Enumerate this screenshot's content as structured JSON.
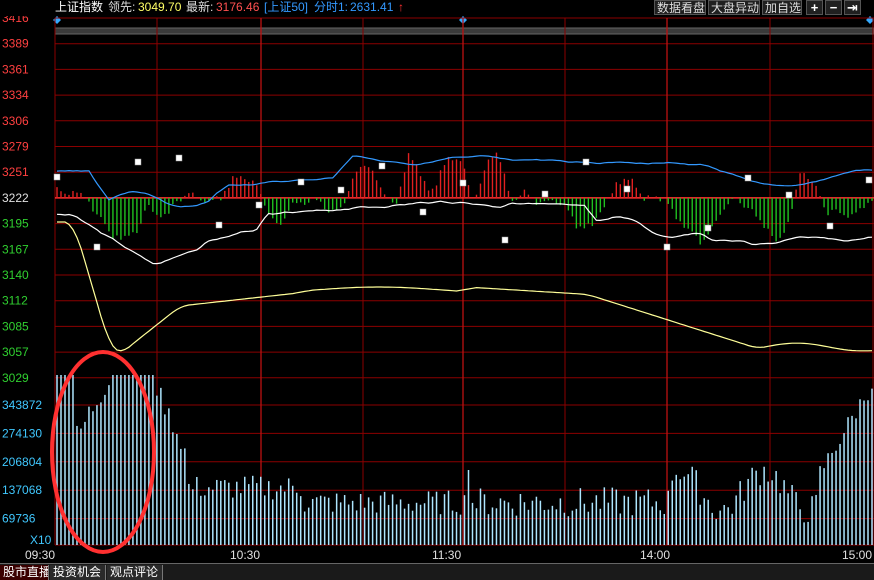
{
  "header": {
    "index_name": "上证指数",
    "leading_label": "领先:",
    "leading_value": "3049.70",
    "latest_label": "最新:",
    "latest_value": "3176.46",
    "sub_index": "[上证50]",
    "intraday_label": "分时1:",
    "intraday_value": "2631.41",
    "arrow": "↑"
  },
  "toolbar": {
    "btn_data": "数据看盘",
    "btn_move": "大盘异动",
    "btn_watch": "加自选",
    "zoom_in": "+",
    "zoom_out": "−",
    "back": "⇥"
  },
  "axes": {
    "price_ticks": [
      "3416",
      "3389",
      "3361",
      "3334",
      "3306",
      "3279",
      "3251",
      "3222",
      "3195",
      "3167",
      "3140",
      "3112",
      "3085",
      "3057",
      "3029"
    ],
    "volume_ticks": [
      "343872",
      "274130",
      "206804",
      "137068",
      "69736"
    ],
    "volume_unit": "X10",
    "time_ticks": [
      "09:30",
      "10:30",
      "11:30",
      "14:00",
      "15:00"
    ]
  },
  "tabs": {
    "live": "股市直播",
    "opportunity": "投资机会",
    "comment": "观点评论"
  },
  "colors": {
    "up": "#e02020",
    "down": "#20c020",
    "grid": "#8b0000",
    "price_line": "#ffffff",
    "avg_line": "#ffff99",
    "blue_line": "#3399ff",
    "volume": "#aee6ff",
    "annotation": "#ff3030"
  }
}
